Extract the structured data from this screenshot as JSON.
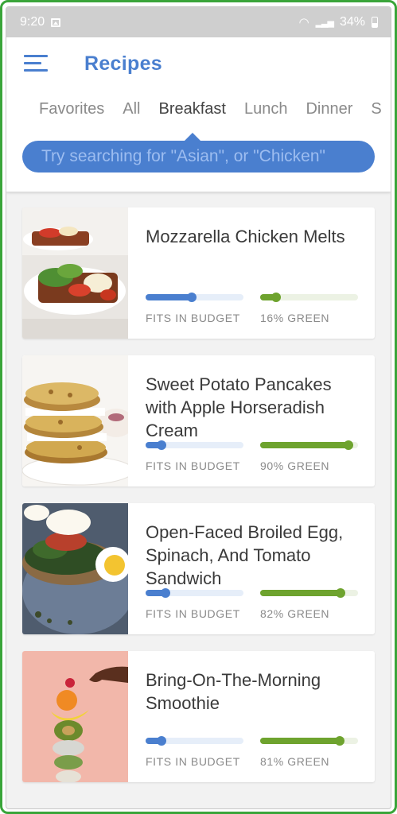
{
  "status_bar": {
    "time": "9:20",
    "battery": "34%"
  },
  "header": {
    "title": "Recipes"
  },
  "tabs": [
    {
      "label": "Favorites",
      "active": false
    },
    {
      "label": "All",
      "active": false
    },
    {
      "label": "Breakfast",
      "active": true
    },
    {
      "label": "Lunch",
      "active": false
    },
    {
      "label": "Dinner",
      "active": false
    },
    {
      "label": "S",
      "active": false
    }
  ],
  "search": {
    "placeholder": "Try searching for \"Asian\", or \"Chicken\""
  },
  "colors": {
    "accent": "#4a7fcf",
    "budget": "#4a7fcf",
    "budget_track": "#e6eef9",
    "green": "#6ea32e",
    "green_track": "#ecf2e4"
  },
  "recipes": [
    {
      "title": "Mozzarella Chicken Melts",
      "budget_label": "FITS IN BUDGET",
      "budget_level": 0.47,
      "green_label": "16% GREEN",
      "green_level": 0.16
    },
    {
      "title": "Sweet Potato Pancakes with Apple Horseradish Cream",
      "budget_label": "FITS IN BUDGET",
      "budget_level": 0.16,
      "green_label": "90% GREEN",
      "green_level": 0.9
    },
    {
      "title": "Open-Faced Broiled Egg, Spinach, And Tomato Sandwich",
      "budget_label": "FITS IN BUDGET",
      "budget_level": 0.2,
      "green_label": "82% GREEN",
      "green_level": 0.82
    },
    {
      "title": "Bring-On-The-Morning Smoothie",
      "budget_label": "FITS IN BUDGET",
      "budget_level": 0.16,
      "green_label": "81% GREEN",
      "green_level": 0.81
    }
  ]
}
